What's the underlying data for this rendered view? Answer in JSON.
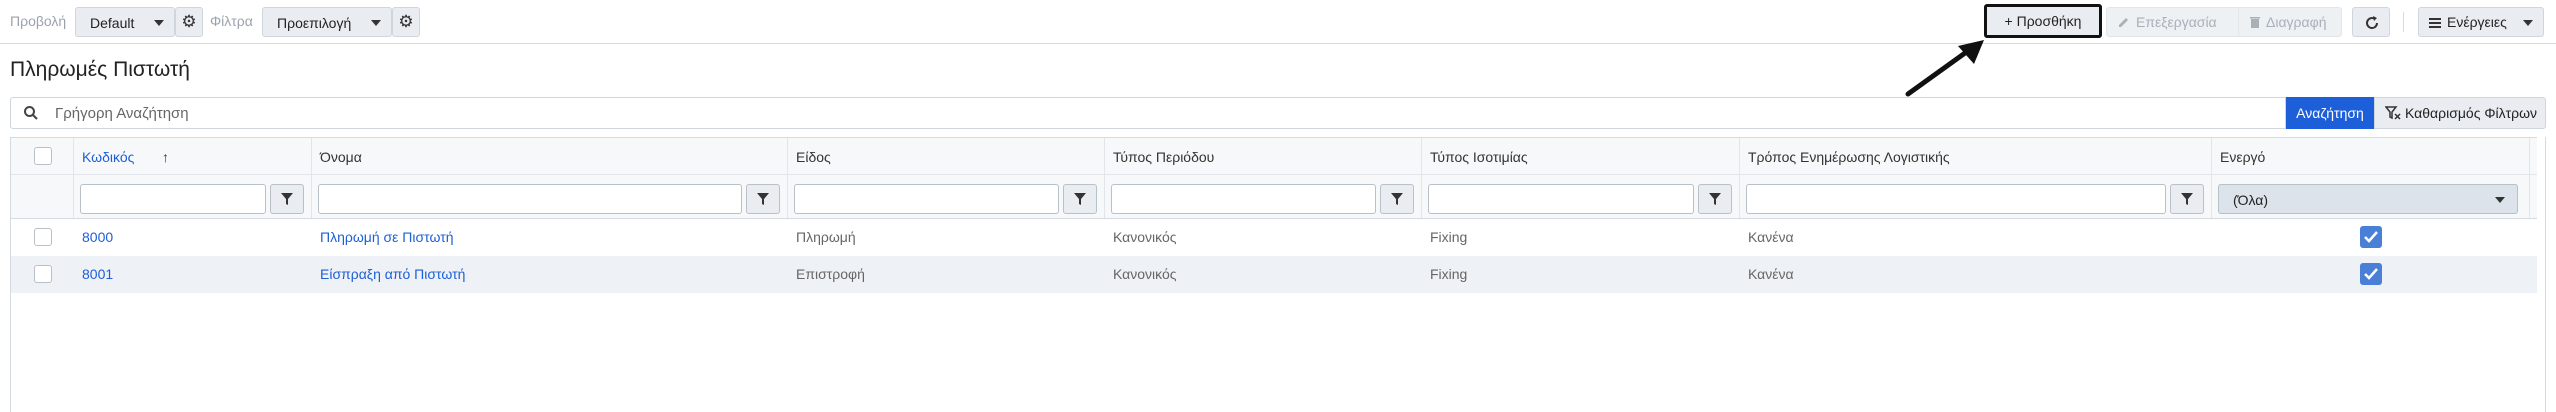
{
  "toolbar": {
    "view_label": "Προβολή",
    "view_value": "Default",
    "filters_label": "Φίλτρα",
    "filters_value": "Προεπιλογή",
    "add_label": "+ Προσθήκη",
    "edit_label": "Επεξεργασία",
    "delete_label": "Διαγραφή",
    "actions_label": "Ενέργειες",
    "icons": [
      "gear-icon",
      "pencil-icon",
      "trash-icon",
      "refresh-icon",
      "menu-icon",
      "chevron-down-icon"
    ]
  },
  "page": {
    "title": "Πληρωμές Πιστωτή"
  },
  "search": {
    "placeholder": "Γρήγορη Αναζήτηση",
    "search_button": "Αναζήτηση",
    "clear_button": "Καθαρισμός Φίλτρων"
  },
  "grid": {
    "columns": [
      "Κωδικός",
      "Όνομα",
      "Είδος",
      "Τύπος Περιόδου",
      "Τύπος Ισοτιμίας",
      "Τρόπος Ενημέρωσης Λογιστικής",
      "Ενεργό"
    ],
    "sort_indicator": "↑",
    "active_filter_value": "(Όλα)",
    "rows": [
      {
        "code": "8000",
        "name": "Πληρωμή σε Πιστωτή",
        "kind": "Πληρωμή",
        "period": "Κανονικός",
        "rate": "Fixing",
        "accounting": "Κανένα",
        "active": true
      },
      {
        "code": "8001",
        "name": "Είσπραξη από Πιστωτή",
        "kind": "Επιστροφή",
        "period": "Κανονικός",
        "rate": "Fixing",
        "accounting": "Κανένα",
        "active": true
      }
    ]
  },
  "colors": {
    "accent": "#1d5fd8",
    "checkbox_on": "#4a7fd8",
    "annotation": "#111111"
  }
}
